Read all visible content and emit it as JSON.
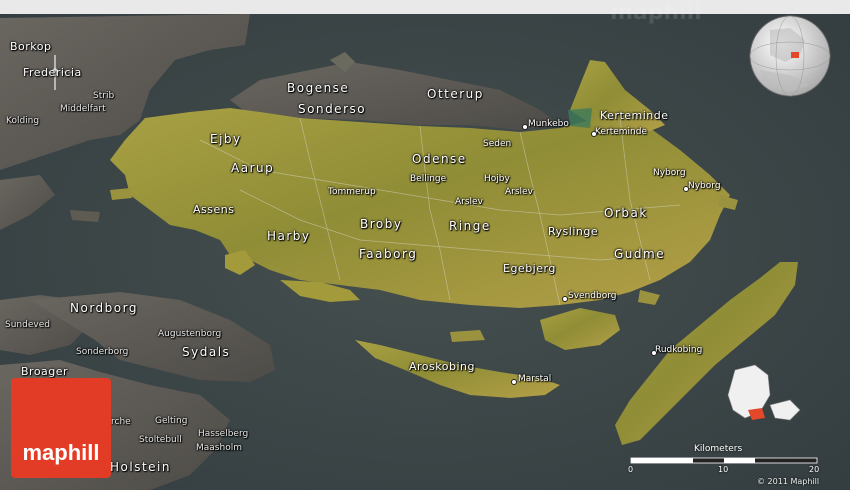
{
  "map": {
    "watermark": "maphill",
    "logo_text": "maphill",
    "copyright": "© 2011 Maphill",
    "scale": {
      "title": "Kilometers",
      "ticks": [
        "0",
        "10",
        "20"
      ]
    },
    "labels_major": {
      "bogense": "Bogense",
      "sonderso": "Sonderso",
      "otterup": "Otterup",
      "ejby": "Ejby",
      "aarup": "Aarup",
      "odense": "Odense",
      "assens": "Assens",
      "harby": "Harby",
      "broby": "Broby",
      "ringe": "Ringe",
      "faaborg": "Faaborg",
      "ryslinge": "Ryslinge",
      "orbak": "Orbak",
      "gudme": "Gudme",
      "nordborg": "Nordborg",
      "sydals": "Sydals",
      "holstein": "Holstein",
      "kerteminde_region": "Kerteminde"
    },
    "labels_minor": {
      "borkop": "Borkop",
      "fredericia": "Fredericia",
      "strib": "Strib",
      "middelfart": "Middelfart",
      "kolding": "Kolding",
      "munkebo": "Munkebo",
      "kerteminde": "Kerteminde",
      "seden": "Seden",
      "bellinge": "Bellinge",
      "hojby": "Hojby",
      "arslev1": "Arslev",
      "arslev2": "Arslev",
      "tommerup": "Tommerup",
      "nyborg1": "Nyborg",
      "nyborg2": "Nyborg",
      "egebjerg": "Egebjerg",
      "svendborg": "Svendborg",
      "rudkobing": "Rudkobing",
      "aroskobing": "Aroskobing",
      "marstal": "Marstal",
      "sundeved": "Sundeved",
      "augustenborg": "Augustenborg",
      "sonderborg": "Sonderborg",
      "broager": "Broager",
      "gelting": "Gelting",
      "rche": "rche",
      "stoltebull": "Stoltebull",
      "hasselberg": "Hasselberg",
      "maasholm": "Maasholm"
    },
    "colors": {
      "sea": "#3b4548",
      "land_main": "#a39a3c",
      "land_dark": "#5a5a52",
      "logo": "#e33c26",
      "highlight": "#e3482a"
    }
  }
}
